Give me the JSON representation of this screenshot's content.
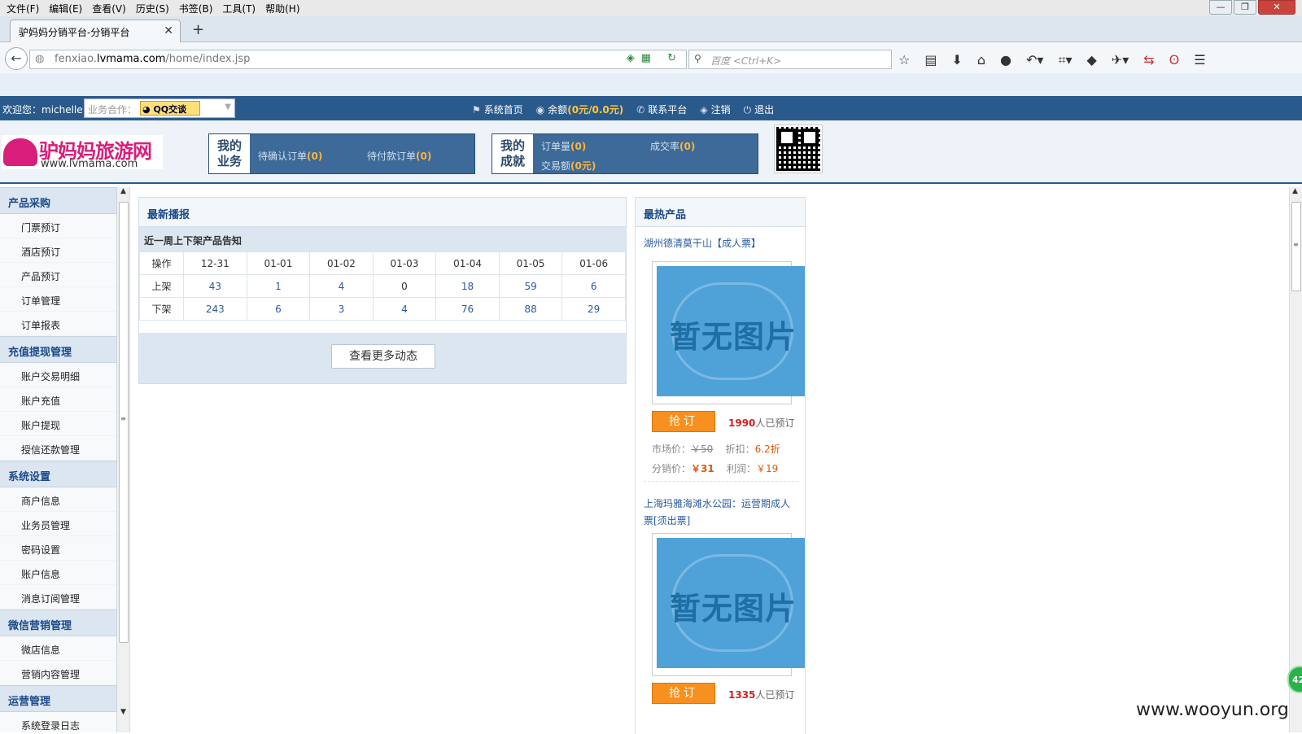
{
  "browser": {
    "menu": [
      "文件(F)",
      "编辑(E)",
      "查看(V)",
      "历史(S)",
      "书签(B)",
      "工具(T)",
      "帮助(H)"
    ],
    "tab_title": "驴妈妈分销平台-分销平台",
    "url_prefix": "fenxiao.",
    "url_domain": "lvmama.com",
    "url_path": "/home/index.jsp",
    "search_placeholder": "百度 <Ctrl+K>"
  },
  "topbar": {
    "welcome": "欢迎您：michelle",
    "biz_label": "业务合作：",
    "qq_button": "QQ交谈",
    "nav": {
      "home": "系统首页",
      "balance_label": "余额",
      "balance_value": "(0元/0.0元)",
      "contact": "联系平台",
      "cancel": "注销",
      "logout": "退出"
    }
  },
  "header": {
    "logo_name": "驴妈妈旅游网",
    "logo_url": "www.lvmama.com",
    "business": {
      "label_line1": "我的",
      "label_line2": "业务",
      "pending_confirm_label": "待确认订单",
      "pending_confirm_value": "(0)",
      "pending_pay_label": "待付款订单",
      "pending_pay_value": "(0)"
    },
    "achievement": {
      "label_line1": "我的",
      "label_line2": "成就",
      "orders_label": "订单量",
      "orders_value": "(0)",
      "rate_label": "成交率",
      "rate_value": "(0)",
      "amount_label": "交易额",
      "amount_value": "(0元)"
    }
  },
  "sidebar": {
    "groups": [
      {
        "title": "产品采购",
        "items": [
          "门票预订",
          "酒店预订",
          "产品预订",
          "订单管理",
          "订单报表"
        ]
      },
      {
        "title": "充值提现管理",
        "items": [
          "账户交易明细",
          "账户充值",
          "账户提现",
          "授信还款管理"
        ]
      },
      {
        "title": "系统设置",
        "items": [
          "商户信息",
          "业务员管理",
          "密码设置",
          "账户信息",
          "消息订阅管理"
        ]
      },
      {
        "title": "微信营销管理",
        "items": [
          "微店信息",
          "营销内容管理"
        ]
      },
      {
        "title": "运营管理",
        "items": [
          "系统登录日志"
        ]
      }
    ]
  },
  "news": {
    "title": "最新播报",
    "subtitle": "近一周上下架产品告知",
    "columns": [
      "操作",
      "12-31",
      "01-01",
      "01-02",
      "01-03",
      "01-04",
      "01-05",
      "01-06"
    ],
    "rows": [
      {
        "label": "上架",
        "values": [
          "43",
          "1",
          "4",
          "0",
          "18",
          "59",
          "6"
        ]
      },
      {
        "label": "下架",
        "values": [
          "243",
          "6",
          "3",
          "4",
          "76",
          "88",
          "29"
        ]
      }
    ],
    "more_button": "查看更多动态"
  },
  "hot": {
    "title": "最热产品",
    "no_image_text": "暂无图片",
    "products": [
      {
        "name": "湖州德清莫干山【成人票】",
        "buy_label": "抢订",
        "booked_count": "1990",
        "booked_suffix": "人已预订",
        "market_label": "市场价：",
        "market_price": "￥50",
        "discount_label": "折扣：",
        "discount": "6.2折",
        "dist_label": "分销价：",
        "dist_price": "￥31",
        "profit_label": "利润：",
        "profit": "￥19"
      },
      {
        "name": "上海玛雅海滩水公园：运营期成人票[须出票]",
        "buy_label": "抢订",
        "booked_count": "1335",
        "booked_suffix": "人已预订"
      }
    ]
  },
  "overlay": {
    "badge": "42",
    "watermark": "www.wooyun.org"
  }
}
